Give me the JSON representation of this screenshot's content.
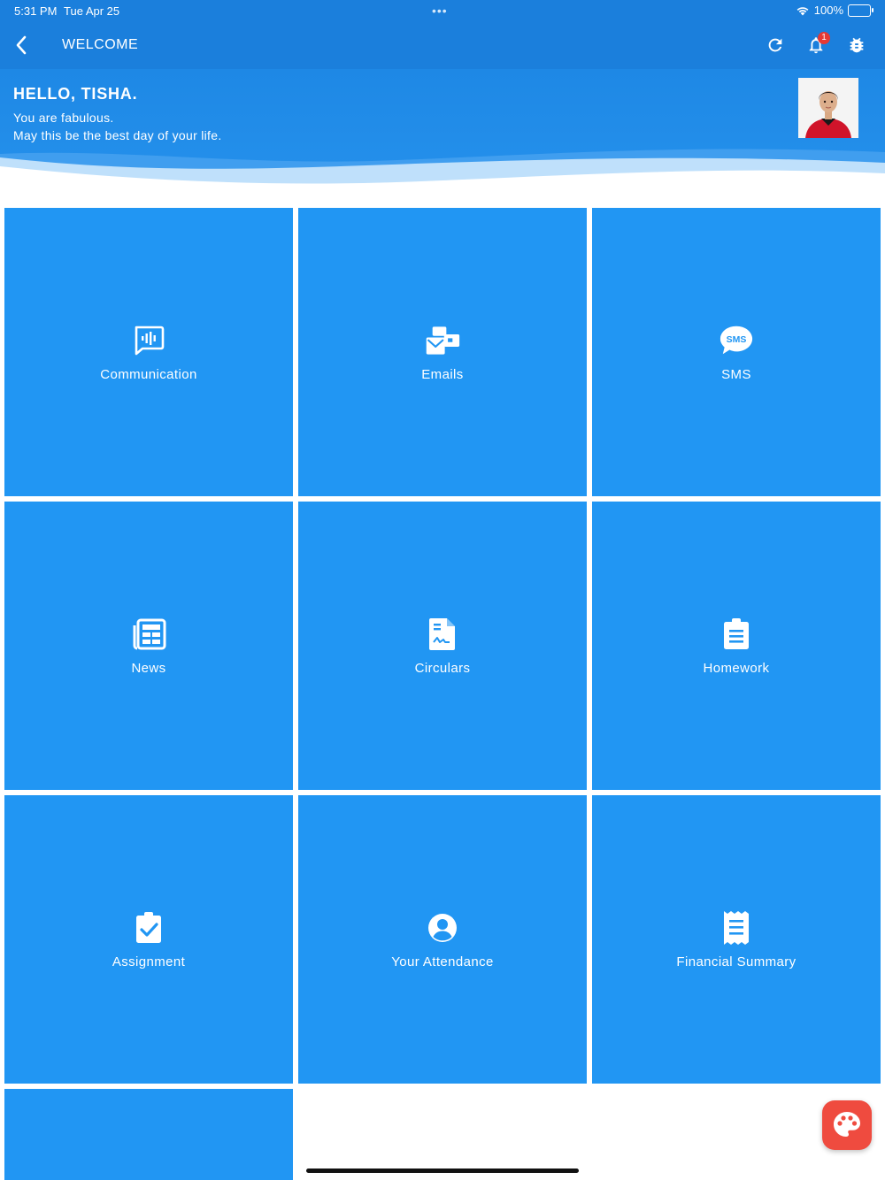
{
  "status_bar": {
    "time": "5:31 PM",
    "date": "Tue Apr 25",
    "battery": "100%"
  },
  "nav": {
    "title": "WELCOME",
    "notification_count": "1"
  },
  "header": {
    "greeting": "HELLO, TISHA.",
    "line1": "You are fabulous.",
    "line2": "May this be the best day of your life."
  },
  "tiles": [
    {
      "label": "Communication",
      "icon": "chat-audio-icon"
    },
    {
      "label": "Emails",
      "icon": "emails-icon"
    },
    {
      "label": "SMS",
      "icon": "sms-icon"
    },
    {
      "label": "News",
      "icon": "newspaper-icon"
    },
    {
      "label": "Circulars",
      "icon": "document-signature-icon"
    },
    {
      "label": "Homework",
      "icon": "clipboard-icon"
    },
    {
      "label": "Assignment",
      "icon": "clipboard-check-icon"
    },
    {
      "label": "Your Attendance",
      "icon": "account-circle-icon"
    },
    {
      "label": "Financial Summary",
      "icon": "receipt-icon"
    }
  ],
  "colors": {
    "primary": "#1b7fdc",
    "tile": "#2196f3",
    "fab": "#ef4b3f",
    "badge": "#e53935"
  }
}
